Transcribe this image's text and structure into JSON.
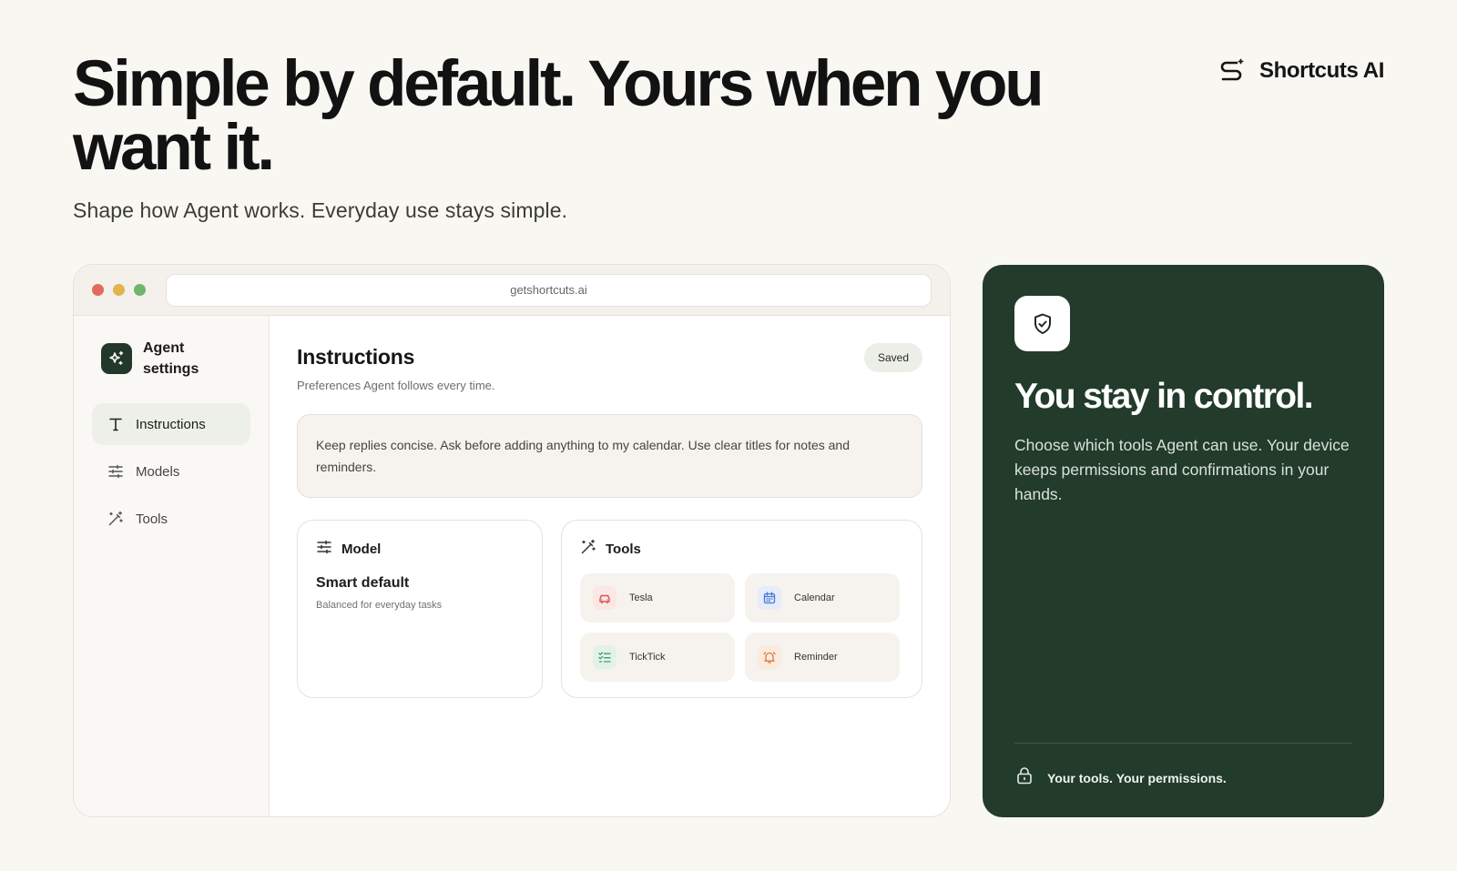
{
  "hero": {
    "headline": "Simple by default. Yours when you want it.",
    "subhead": "Shape how Agent works. Everyday use stays simple."
  },
  "brand": {
    "name": "Shortcuts AI",
    "icon": "shortcuts-logo-icon"
  },
  "browser": {
    "url": "getshortcuts.ai",
    "traffic_lights": [
      "#e06b5b",
      "#e3b34c",
      "#6fb56b"
    ]
  },
  "sidebar": {
    "title": "Agent settings",
    "items": [
      {
        "label": "Instructions",
        "icon": "text-icon",
        "active": true
      },
      {
        "label": "Models",
        "icon": "sliders-icon",
        "active": false
      },
      {
        "label": "Tools",
        "icon": "magic-wand-icon",
        "active": false
      }
    ]
  },
  "main": {
    "title": "Instructions",
    "description": "Preferences Agent follows every time.",
    "status": "Saved",
    "instructions_text": "Keep replies concise. Ask before adding anything to my calendar. Use clear titles for notes and reminders."
  },
  "model_card": {
    "heading": "Model",
    "name": "Smart default",
    "description": "Balanced for everyday tasks"
  },
  "tools_card": {
    "heading": "Tools",
    "items": [
      {
        "label": "Tesla",
        "icon": "car-icon",
        "color": "#d9534f"
      },
      {
        "label": "Calendar",
        "icon": "calendar-icon",
        "color": "#4a78d6"
      },
      {
        "label": "TickTick",
        "icon": "checklist-icon",
        "color": "#3f9c6a"
      },
      {
        "label": "Reminder",
        "icon": "bell-icon",
        "color": "#e07a3a"
      }
    ]
  },
  "panel": {
    "title": "You stay in control.",
    "text": "Choose which tools Agent can use. Your device keeps permissions and confirmations in your hands.",
    "footer": "Your tools. Your permissions.",
    "accent": "#223b2a"
  }
}
